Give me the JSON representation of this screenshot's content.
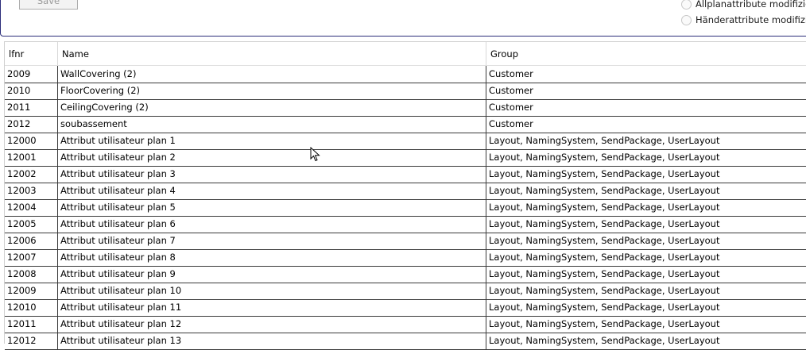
{
  "toolbar": {
    "save_label": "Save"
  },
  "options": [
    {
      "label": "Allplanattribute modifiziere"
    },
    {
      "label": "Händerattribute modifiziere"
    }
  ],
  "grid": {
    "columns": [
      "lfnr",
      "Name",
      "Group"
    ],
    "rows": [
      {
        "lfnr": "2009",
        "name": "WallCovering (2)",
        "group": "Customer"
      },
      {
        "lfnr": "2010",
        "name": "FloorCovering (2)",
        "group": "Customer"
      },
      {
        "lfnr": "2011",
        "name": "CeilingCovering (2)",
        "group": "Customer"
      },
      {
        "lfnr": "2012",
        "name": "soubassement",
        "group": "Customer"
      },
      {
        "lfnr": "12000",
        "name": "Attribut utilisateur plan 1",
        "group": "Layout, NamingSystem, SendPackage, UserLayout"
      },
      {
        "lfnr": "12001",
        "name": "Attribut utilisateur plan 2",
        "group": "Layout, NamingSystem, SendPackage, UserLayout"
      },
      {
        "lfnr": "12002",
        "name": "Attribut utilisateur plan 3",
        "group": "Layout, NamingSystem, SendPackage, UserLayout"
      },
      {
        "lfnr": "12003",
        "name": "Attribut utilisateur plan 4",
        "group": "Layout, NamingSystem, SendPackage, UserLayout"
      },
      {
        "lfnr": "12004",
        "name": "Attribut utilisateur plan 5",
        "group": "Layout, NamingSystem, SendPackage, UserLayout"
      },
      {
        "lfnr": "12005",
        "name": "Attribut utilisateur plan 6",
        "group": "Layout, NamingSystem, SendPackage, UserLayout"
      },
      {
        "lfnr": "12006",
        "name": "Attribut utilisateur plan 7",
        "group": "Layout, NamingSystem, SendPackage, UserLayout"
      },
      {
        "lfnr": "12007",
        "name": "Attribut utilisateur plan 8",
        "group": "Layout, NamingSystem, SendPackage, UserLayout"
      },
      {
        "lfnr": "12008",
        "name": "Attribut utilisateur plan 9",
        "group": "Layout, NamingSystem, SendPackage, UserLayout"
      },
      {
        "lfnr": "12009",
        "name": "Attribut utilisateur plan 10",
        "group": "Layout, NamingSystem, SendPackage, UserLayout"
      },
      {
        "lfnr": "12010",
        "name": "Attribut utilisateur plan 11",
        "group": "Layout, NamingSystem, SendPackage, UserLayout"
      },
      {
        "lfnr": "12011",
        "name": "Attribut utilisateur plan 12",
        "group": "Layout, NamingSystem, SendPackage, UserLayout"
      },
      {
        "lfnr": "12012",
        "name": "Attribut utilisateur plan 13",
        "group": "Layout, NamingSystem, SendPackage, UserLayout"
      }
    ]
  },
  "icons": {
    "cursor": "mouse-pointer-icon"
  }
}
